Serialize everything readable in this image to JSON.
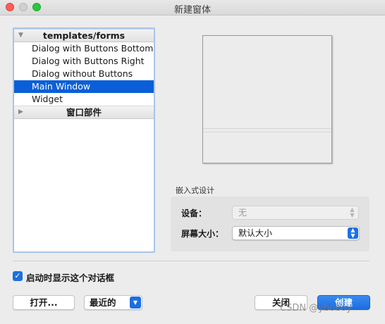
{
  "window": {
    "title": "新建窗体"
  },
  "templates": {
    "groups": [
      {
        "name": "templates/forms",
        "expanded": true,
        "items": [
          "Dialog with Buttons Bottom",
          "Dialog with Buttons Right",
          "Dialog without Buttons",
          "Main Window",
          "Widget"
        ],
        "selected": "Main Window"
      },
      {
        "name": "窗口部件",
        "expanded": false
      }
    ]
  },
  "embedded": {
    "section_label": "嵌入式设计",
    "device_label": "设备：",
    "device_value": "无",
    "screen_size_label": "屏幕大小：",
    "screen_size_value": "默认大小"
  },
  "options": {
    "show_on_startup": "启动时显示这个对话框",
    "show_on_startup_checked": true
  },
  "buttons": {
    "open": "打开...",
    "recent": "最近的",
    "close": "关闭",
    "create": "创建"
  },
  "watermark": "CSDN @yboboy",
  "colors": {
    "accent": "#1b6fe0",
    "selection": "#0a5fd8"
  }
}
